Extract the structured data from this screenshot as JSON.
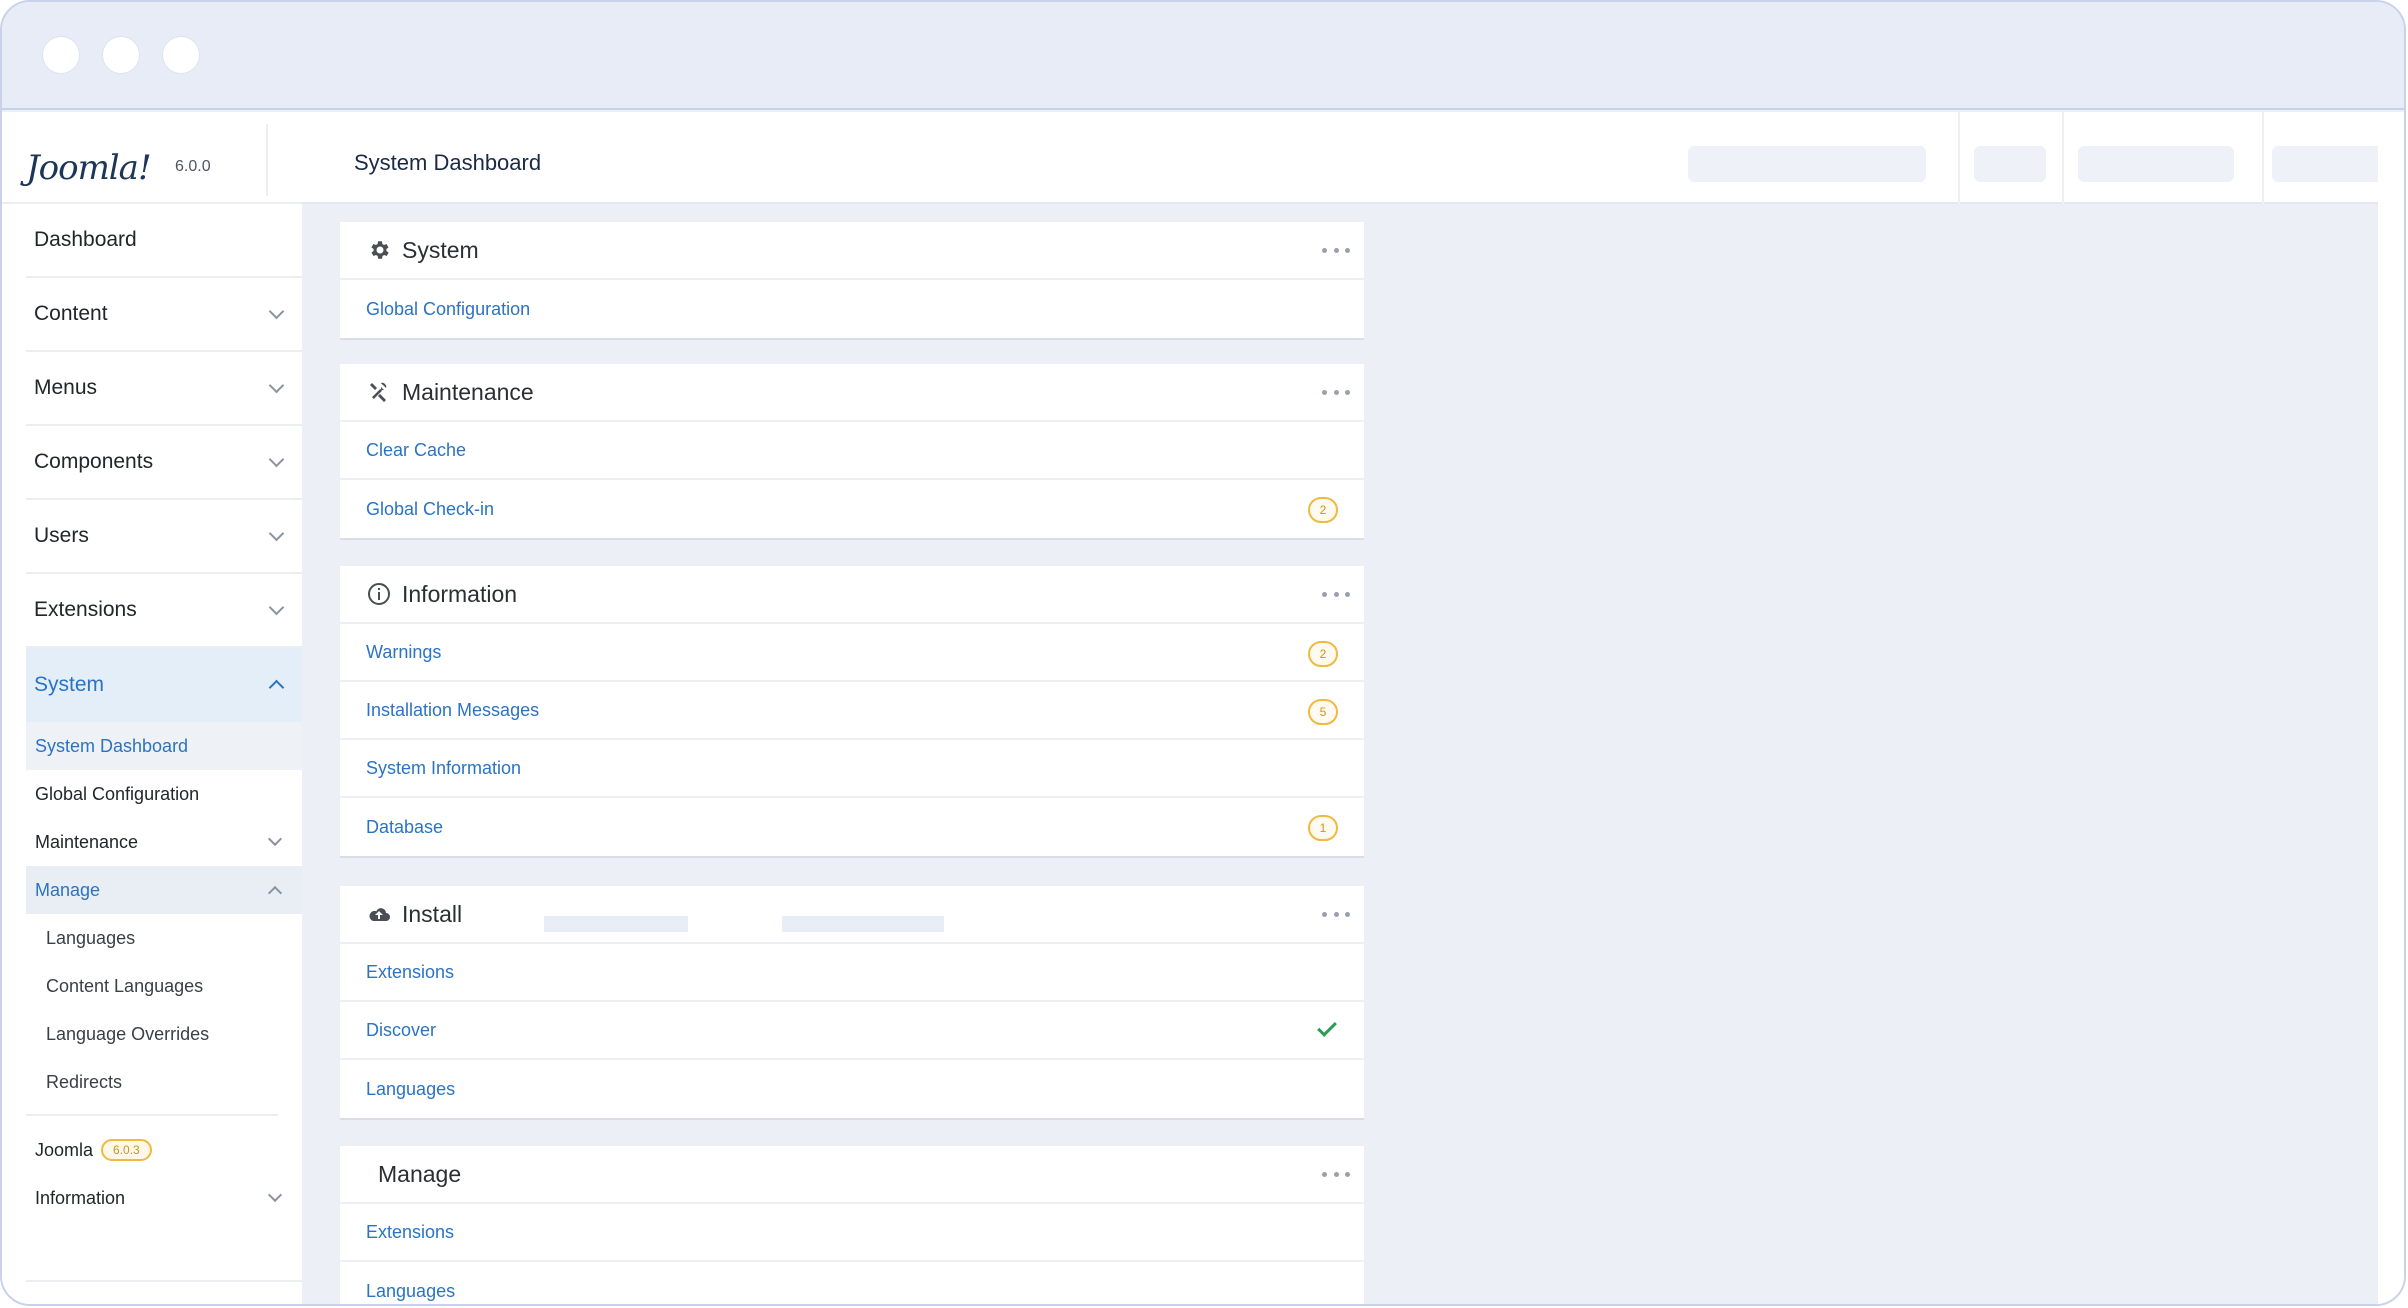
{
  "app": {
    "logo": "Joomla!",
    "version": "6.0.0",
    "page_title": "System Dashboard"
  },
  "sidebar": {
    "items": [
      {
        "label": "Dashboard"
      },
      {
        "label": "Content"
      },
      {
        "label": "Menus"
      },
      {
        "label": "Components"
      },
      {
        "label": "Users"
      },
      {
        "label": "Extensions"
      },
      {
        "label": "System"
      }
    ],
    "system_sub": [
      {
        "label": "System Dashboard"
      },
      {
        "label": "Global Configuration"
      },
      {
        "label": "Maintenance"
      },
      {
        "label": "Manage"
      }
    ],
    "manage_sub": [
      {
        "label": "Languages"
      },
      {
        "label": "Content Languages"
      },
      {
        "label": "Language Overrides"
      },
      {
        "label": "Redirects"
      }
    ],
    "joomla": {
      "label": "Joomla",
      "badge": "6.0.3"
    },
    "information": {
      "label": "Information"
    }
  },
  "cards": {
    "system": {
      "title": "System",
      "rows": [
        {
          "label": "Global Configuration"
        }
      ]
    },
    "maintenance": {
      "title": "Maintenance",
      "rows": [
        {
          "label": "Clear Cache"
        },
        {
          "label": "Global Check-in",
          "count": "2"
        }
      ]
    },
    "information": {
      "title": "Information",
      "rows": [
        {
          "label": "Warnings",
          "count": "2"
        },
        {
          "label": "Installation Messages",
          "count": "5"
        },
        {
          "label": "System Information"
        },
        {
          "label": "Database",
          "count": "1"
        }
      ]
    },
    "install": {
      "title": "Install",
      "rows": [
        {
          "label": "Extensions"
        },
        {
          "label": "Discover"
        },
        {
          "label": "Languages"
        }
      ]
    },
    "manage": {
      "title": "Manage",
      "rows": [
        {
          "label": "Extensions"
        },
        {
          "label": "Languages"
        }
      ]
    }
  },
  "colors": {
    "link": "#2a73c5",
    "badge": "#f0b940",
    "check": "#2c9b55",
    "active_bg": "#e3eef9"
  },
  "icons": {
    "system": "gear-icon",
    "maintenance": "tools-icon",
    "information": "info-icon",
    "install": "cloud-upload-icon",
    "more": "ellipsis-icon",
    "discover_status": "check-icon"
  }
}
